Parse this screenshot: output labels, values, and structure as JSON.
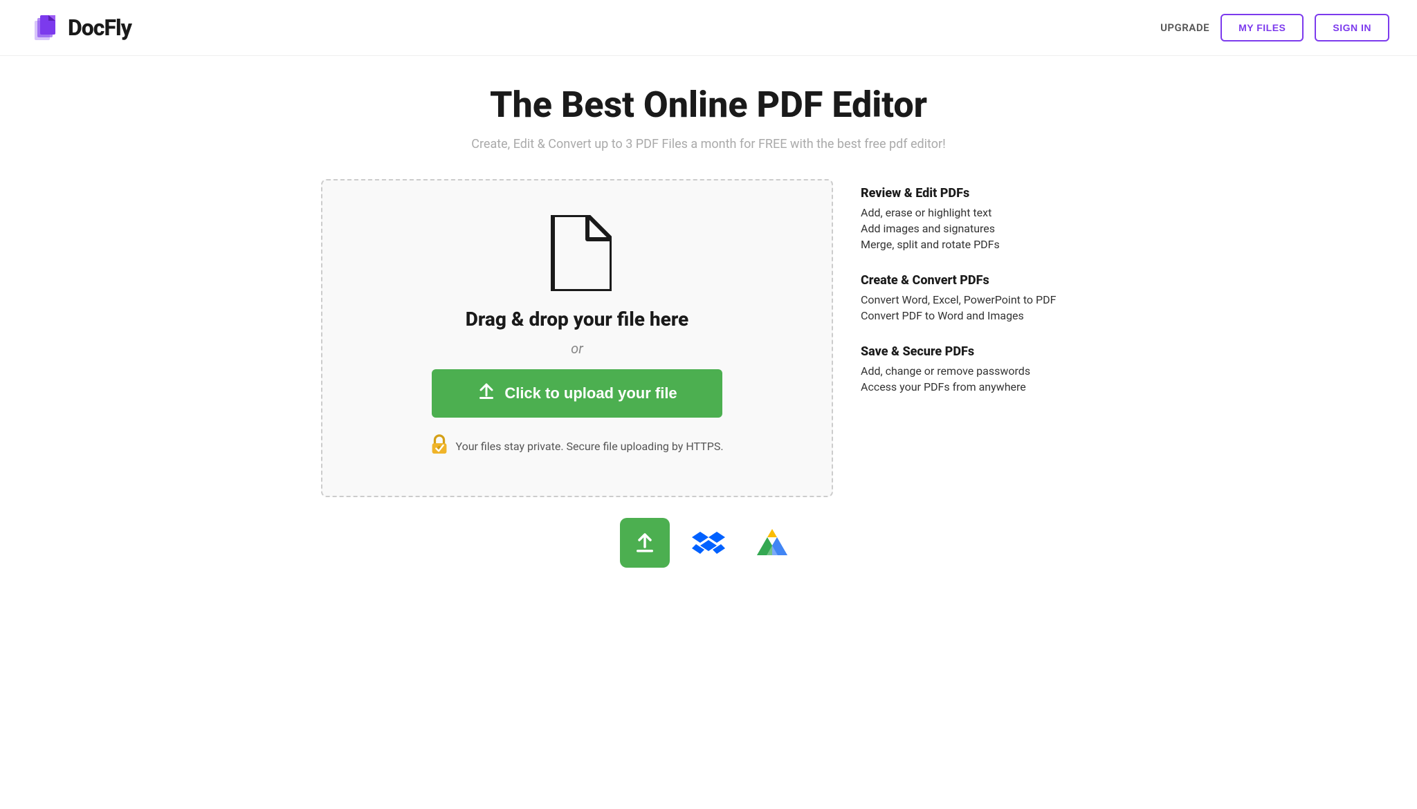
{
  "header": {
    "logo_text": "DocFly",
    "nav": {
      "upgrade_label": "UPGRADE",
      "my_files_label": "MY FILES",
      "sign_in_label": "SIGN IN"
    }
  },
  "hero": {
    "title": "The Best Online PDF Editor",
    "subtitle": "Create, Edit & Convert up to 3 PDF Files a month for FREE with the best free pdf editor!"
  },
  "dropzone": {
    "drag_drop_text": "Drag & drop your file here",
    "or_text": "or",
    "upload_btn_label": "Click to upload your file",
    "security_text": "Your files stay private. Secure file uploading by HTTPS."
  },
  "features": [
    {
      "heading": "Review & Edit PDFs",
      "items": [
        "Add, erase or highlight text",
        "Add images and signatures",
        "Merge, split and rotate PDFs"
      ]
    },
    {
      "heading": "Create & Convert PDFs",
      "items": [
        "Convert Word, Excel, PowerPoint to PDF",
        "Convert PDF to Word and Images"
      ]
    },
    {
      "heading": "Save & Secure PDFs",
      "items": [
        "Add, change or remove passwords",
        "Access your PDFs from anywhere"
      ]
    }
  ],
  "upload_sources": [
    {
      "name": "local-upload",
      "icon": "⬆"
    },
    {
      "name": "dropbox",
      "icon": "◆"
    },
    {
      "name": "google-drive",
      "icon": "▲"
    }
  ],
  "colors": {
    "green": "#4caf50",
    "purple": "#7c3aed",
    "dark": "#1a1a1a"
  }
}
